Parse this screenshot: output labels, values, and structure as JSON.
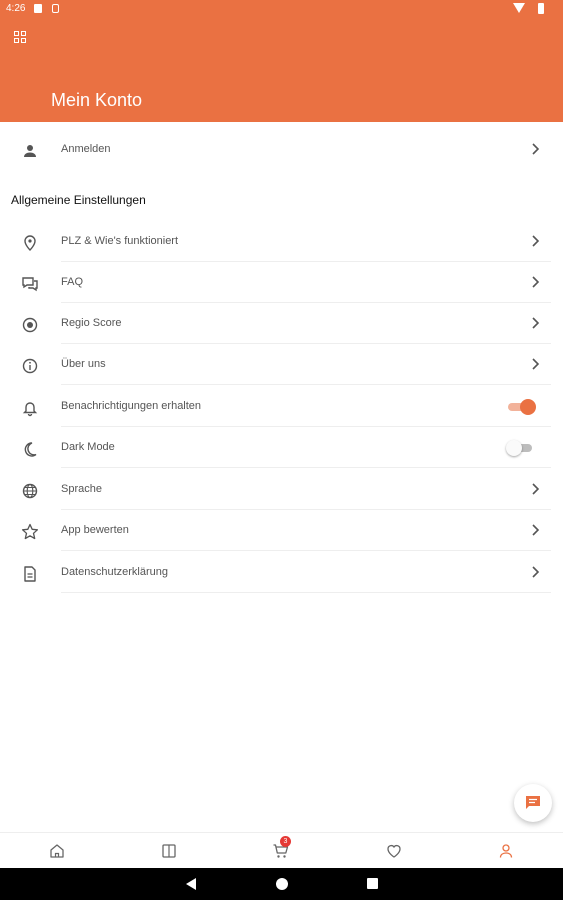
{
  "status_bar": {
    "time": "4:26"
  },
  "header": {
    "title": "Mein Konto",
    "menu_icon": "grid-menu-icon",
    "background": "#EA7142"
  },
  "account": {
    "label": "Anmelden",
    "icon": "person-icon"
  },
  "settings": {
    "section_title": "Allgemeine Einstellungen",
    "items": [
      {
        "label": "PLZ & Wie's funktioniert",
        "icon": "location-pin-icon",
        "control": "chevron"
      },
      {
        "label": "FAQ",
        "icon": "chat-bubbles-icon",
        "control": "chevron"
      },
      {
        "label": "Regio Score",
        "icon": "target-icon",
        "control": "chevron"
      },
      {
        "label": "Über uns",
        "icon": "info-icon",
        "control": "chevron"
      },
      {
        "label": "Benachrichtigungen erhalten",
        "icon": "bell-icon",
        "control": "toggle",
        "enabled": true
      },
      {
        "label": "Dark Mode",
        "icon": "moon-icon",
        "control": "toggle",
        "enabled": false
      },
      {
        "label": "Sprache",
        "icon": "globe-icon",
        "control": "chevron"
      },
      {
        "label": "App bewerten",
        "icon": "star-icon",
        "control": "chevron"
      },
      {
        "label": "Datenschutzerklärung",
        "icon": "document-icon",
        "control": "chevron"
      }
    ]
  },
  "fab": {
    "icon": "chat-icon"
  },
  "bottom_nav": {
    "items": [
      {
        "icon": "home-icon"
      },
      {
        "icon": "book-icon"
      },
      {
        "icon": "cart-icon",
        "badge": "3"
      },
      {
        "icon": "heart-icon"
      },
      {
        "icon": "profile-icon",
        "active": true
      }
    ],
    "active_color": "#EA7142"
  },
  "system_nav": {
    "icons": [
      "back-icon",
      "home-circle-icon",
      "recents-icon"
    ]
  }
}
